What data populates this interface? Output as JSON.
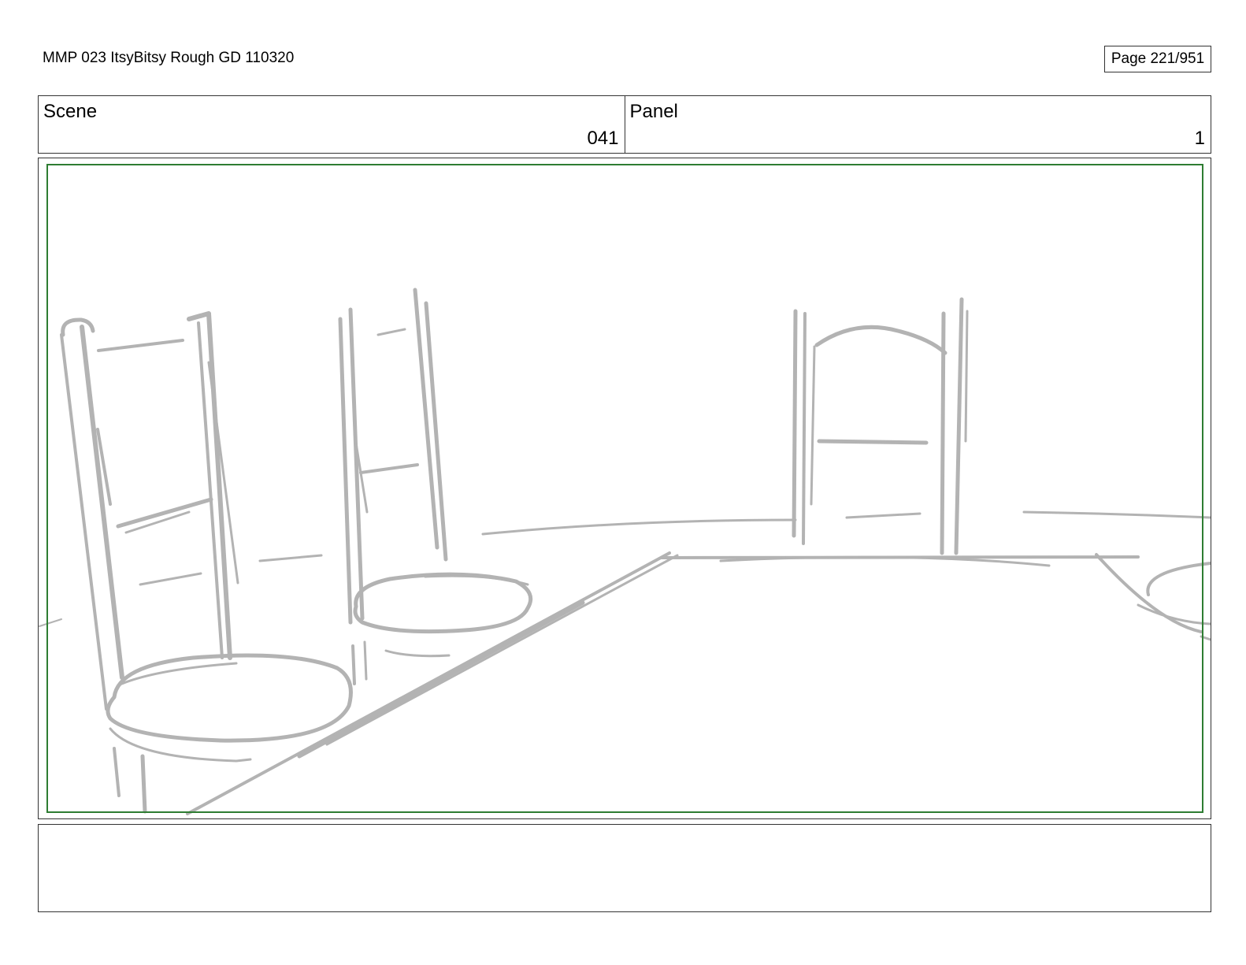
{
  "header": {
    "document_title": "MMP 023 ItsyBitsy Rough GD 110320",
    "page_label": "Page 221/951"
  },
  "info_row": {
    "scene_label": "Scene",
    "scene_value": "041",
    "panel_label": "Panel",
    "panel_value": "1"
  },
  "frame": {
    "border_color": "#2e7d32",
    "sketch_color": "#b3b3b3"
  },
  "notes": {
    "text": ""
  }
}
